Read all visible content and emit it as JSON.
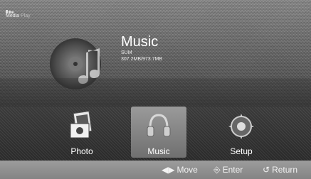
{
  "brand": {
    "line1": "Media",
    "line2": "Play"
  },
  "header": {
    "title": "Music",
    "device": "SUM",
    "storage": "307.2MB/973.7MB"
  },
  "menu": {
    "items": [
      {
        "label": "Photo",
        "icon": "photo-icon",
        "selected": false
      },
      {
        "label": "Music",
        "icon": "headphones-icon",
        "selected": true
      },
      {
        "label": "Setup",
        "icon": "setup-icon",
        "selected": false
      }
    ]
  },
  "footer": {
    "move_label": "Move",
    "enter_label": "Enter",
    "return_label": "Return"
  }
}
